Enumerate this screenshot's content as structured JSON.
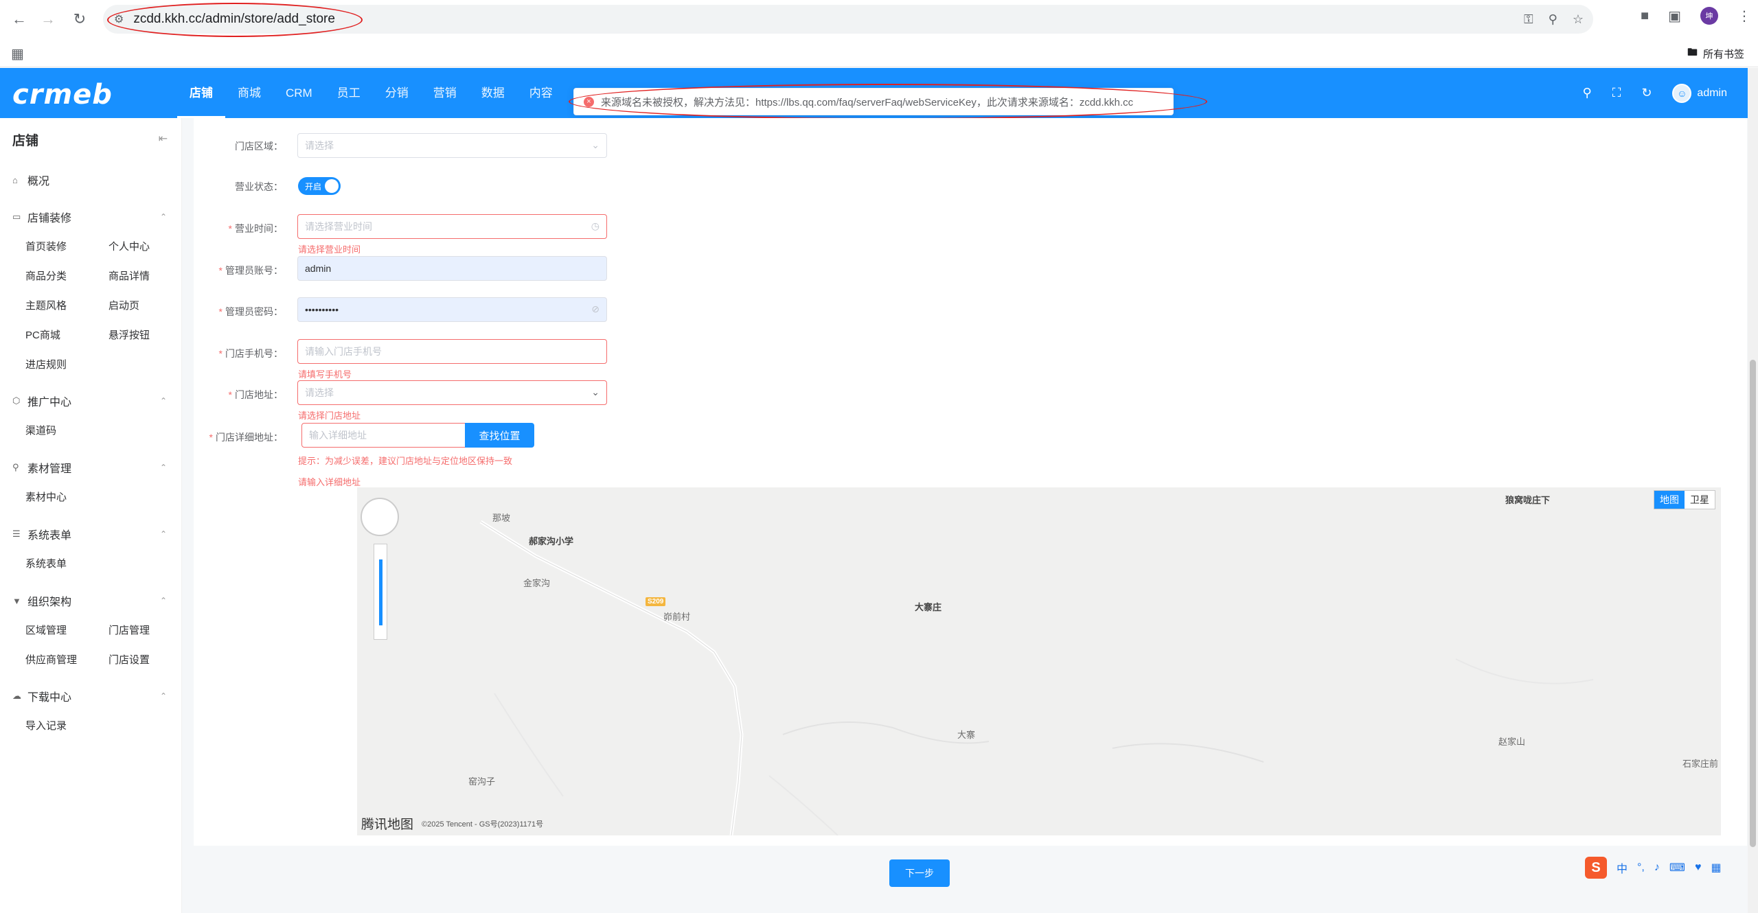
{
  "browser": {
    "url": "zcdd.kkh.cc/admin/store/add_store",
    "bookmarks_all": "所有书签",
    "profile_initial": "坤"
  },
  "header": {
    "logo": "crmeb",
    "nav": [
      "店铺",
      "商城",
      "CRM",
      "员工",
      "分销",
      "营销",
      "数据",
      "内容"
    ],
    "active_nav": "店铺",
    "user": "admin"
  },
  "toast": {
    "message": "来源域名未被授权，解决方法见：https://lbs.qq.com/faq/serverFaq/webServiceKey，此次请求来源域名：zcdd.kkh.cc"
  },
  "sidebar": {
    "title": "店铺",
    "groups": [
      {
        "label": "概况",
        "items": []
      },
      {
        "label": "店铺装修",
        "items": [
          "首页装修",
          "个人中心",
          "商品分类",
          "商品详情",
          "主题风格",
          "启动页",
          "PC商城",
          "悬浮按钮",
          "进店规则"
        ]
      },
      {
        "label": "推广中心",
        "items": [
          "渠道码"
        ]
      },
      {
        "label": "素材管理",
        "items": [
          "素材中心"
        ]
      },
      {
        "label": "系统表单",
        "items": [
          "系统表单"
        ]
      },
      {
        "label": "组织架构",
        "items": [
          "区域管理",
          "门店管理",
          "供应商管理",
          "门店设置"
        ]
      },
      {
        "label": "下载中心",
        "items": [
          "导入记录"
        ]
      }
    ]
  },
  "form": {
    "region": {
      "label": "门店区域：",
      "placeholder": "请选择"
    },
    "status": {
      "label": "营业状态：",
      "value": "开启"
    },
    "hours": {
      "label": "营业时间：",
      "placeholder": "请选择营业时间",
      "error": "请选择营业时间"
    },
    "account": {
      "label": "管理员账号：",
      "value": "admin"
    },
    "password": {
      "label": "管理员密码：",
      "value": "••••••••••"
    },
    "phone": {
      "label": "门店手机号：",
      "placeholder": "请输入门店手机号",
      "error": "请填写手机号"
    },
    "address": {
      "label": "门店地址：",
      "placeholder": "请选择",
      "error": "请选择门店地址"
    },
    "detail": {
      "label": "门店详细地址：",
      "placeholder": "输入详细地址",
      "button": "查找位置",
      "hint": "提示：为减少误差，建议门店地址与定位地区保持一致",
      "error": "请输入详细地址"
    }
  },
  "map": {
    "tabs": [
      "地图",
      "卫星"
    ],
    "labels": [
      "那坡",
      "郝家沟小学",
      "金家沟",
      "峁前村",
      "大寨庄",
      "狼窝咙庄下",
      "大寨",
      "赵家山",
      "石家庄前",
      "窑沟子"
    ],
    "road": "S209",
    "brand": "腾讯地图",
    "copyright": "©2025 Tencent - GS号(2023)1171号"
  },
  "actions": {
    "next": "下一步"
  },
  "ime": {
    "lang": "中",
    "punct": "°,"
  }
}
